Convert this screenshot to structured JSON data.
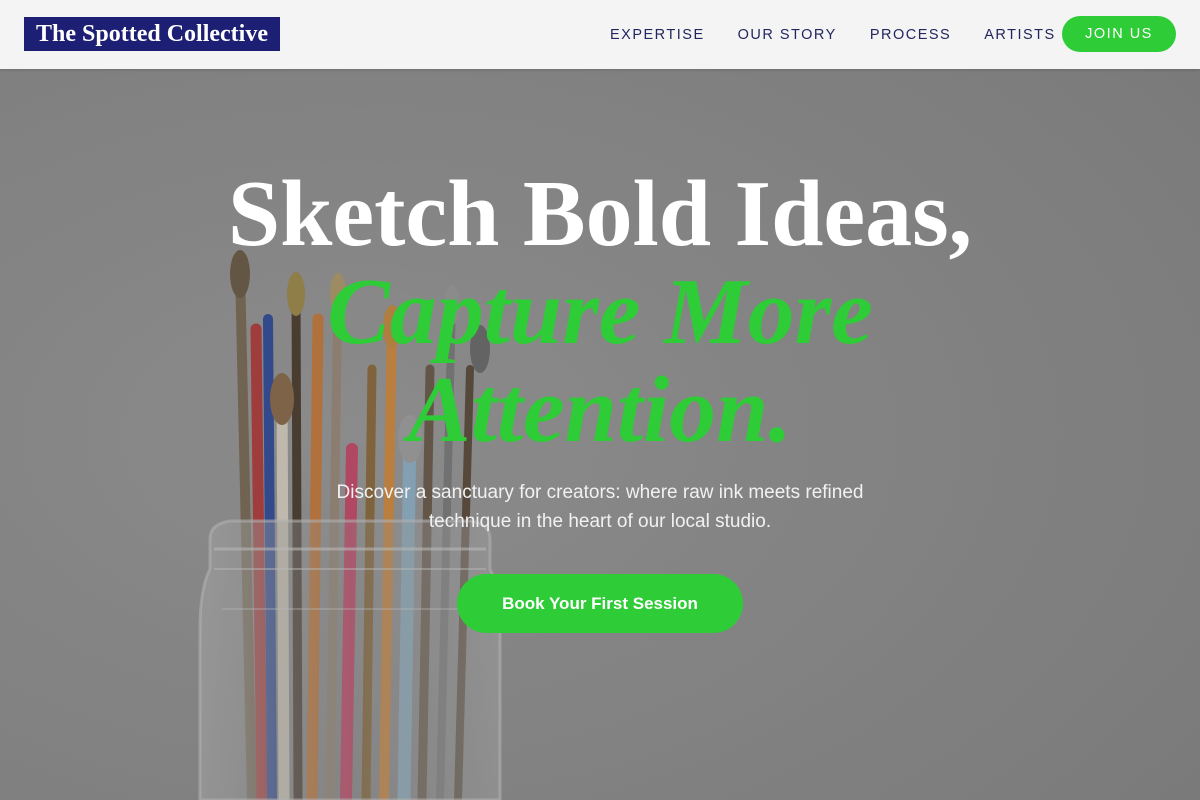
{
  "brand": {
    "name": "The Spotted Collective"
  },
  "nav": {
    "links": [
      "EXPERTISE",
      "OUR STORY",
      "PROCESS",
      "ARTISTS"
    ],
    "cta_label": "JOIN US"
  },
  "hero": {
    "headline_line1": "Sketch Bold Ideas,",
    "headline_line2": "Capture More",
    "headline_line3": "Attention.",
    "subtext": "Discover a sanctuary for creators: where raw ink meets refined technique in the heart of our local studio.",
    "cta_label": "Book Your First Session",
    "background_image": "paintbrushes-in-glass-jar"
  },
  "colors": {
    "brand_navy": "#1c1f73",
    "accent_green": "#2ecc36",
    "nav_background": "#f4f4f4",
    "nav_text": "#23255e"
  }
}
